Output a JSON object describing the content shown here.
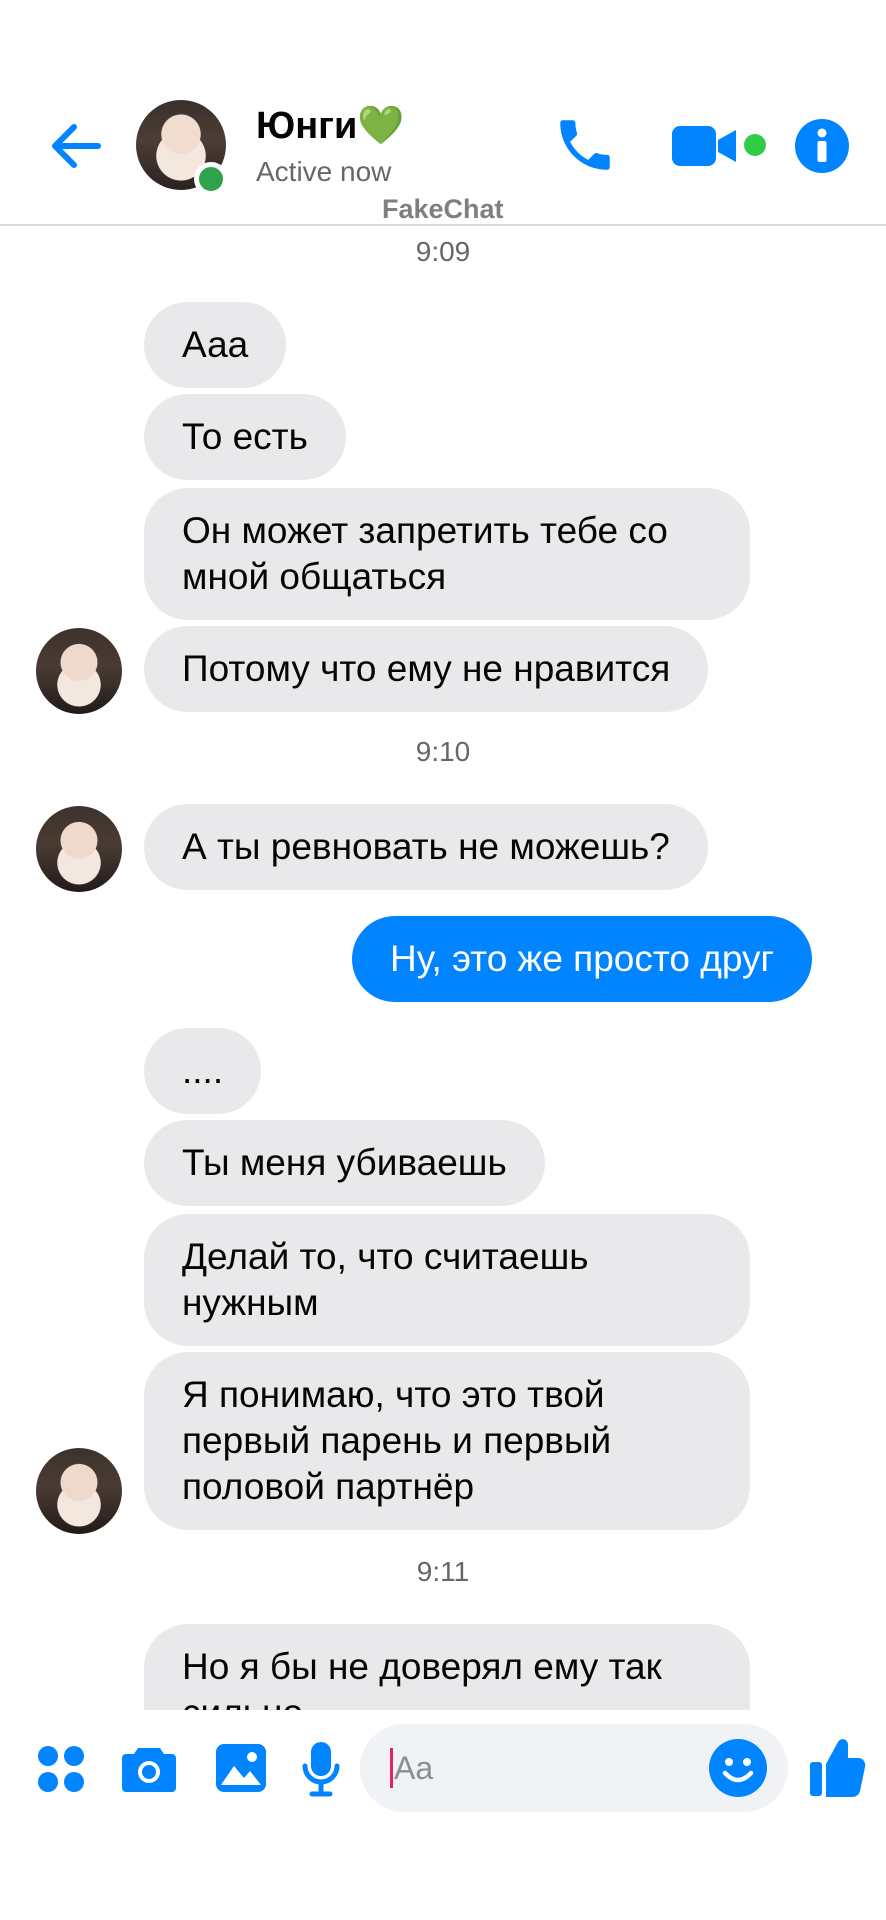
{
  "header": {
    "contact_name": "Юнги💚",
    "status": "Active now",
    "watermark": "FakeChat",
    "icons": [
      "arrow-left-icon",
      "phone-icon",
      "video-camera-icon",
      "info-icon"
    ],
    "accent_color": "#0084ff",
    "online_color": "#31a24c"
  },
  "thread": {
    "timestamps": [
      "9:09",
      "9:10",
      "9:11"
    ],
    "messages": [
      {
        "from": "contact",
        "text": "Ааа"
      },
      {
        "from": "contact",
        "text": "То есть"
      },
      {
        "from": "contact",
        "text": "Он может запретить тебе со мной общаться"
      },
      {
        "from": "contact",
        "text": "Потому что ему не нравится"
      },
      {
        "from": "contact",
        "text": "А ты ревновать не можешь?"
      },
      {
        "from": "me",
        "text": "Ну, это же просто друг"
      },
      {
        "from": "contact",
        "text": "...."
      },
      {
        "from": "contact",
        "text": "Ты меня убиваешь"
      },
      {
        "from": "contact",
        "text": "Делай то, что считаешь нужным"
      },
      {
        "from": "contact",
        "text": "Я понимаю, что это твой первый парень и первый половой партнёр"
      },
      {
        "from": "contact",
        "text": "Но я бы не доверял ему так сильно"
      }
    ],
    "incoming_bubble_color": "#e9e9eb",
    "outgoing_bubble_color": "#0084ff"
  },
  "composer": {
    "placeholder": "Aa",
    "value": "",
    "icons": [
      "apps-icon",
      "camera-icon",
      "image-icon",
      "microphone-icon",
      "emoji-icon",
      "thumbs-up-icon"
    ]
  }
}
